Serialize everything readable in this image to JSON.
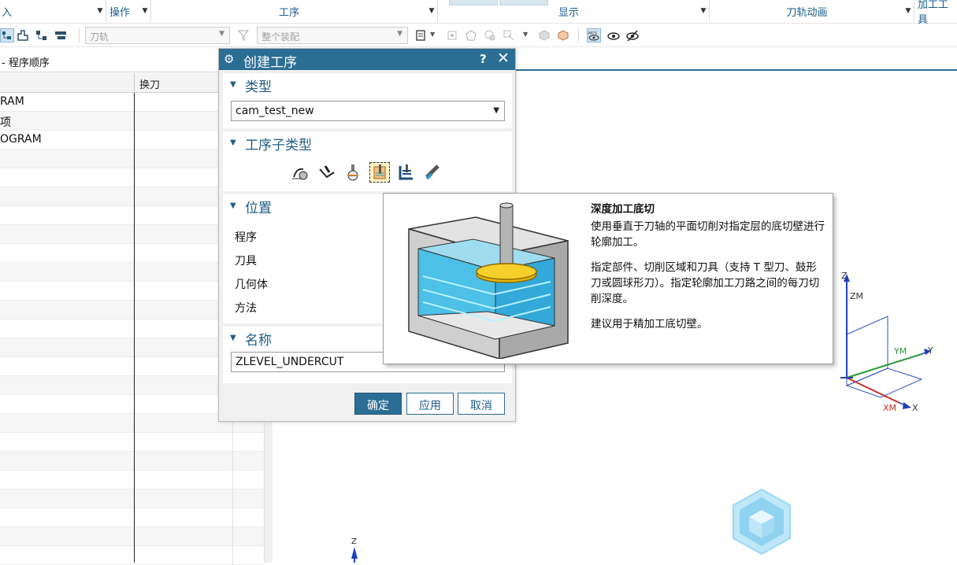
{
  "ribbon": {
    "groups": [
      {
        "label": "入",
        "has_arrow": true
      },
      {
        "label": "操作",
        "has_arrow": true
      },
      {
        "label": "工序",
        "has_arrow": true
      },
      {
        "label": "显示",
        "has_arrow": true
      },
      {
        "label": "刀轨动画",
        "has_arrow": true
      },
      {
        "label": "加工工具",
        "has_arrow": false
      }
    ]
  },
  "toolbar": {
    "toolpath_combo": "刀轨",
    "assembly_combo": "整个装配"
  },
  "navigator": {
    "title": "- 程序顺序",
    "columns": [
      "",
      "换刀"
    ],
    "rows": [
      "RAM",
      "项",
      "OGRAM",
      "",
      "",
      "",
      "",
      "",
      "",
      "",
      "",
      "",
      "",
      "",
      "",
      "",
      "",
      "",
      "",
      "",
      "",
      "",
      "",
      "",
      ""
    ]
  },
  "dialog": {
    "title": "创建工序",
    "help": "?",
    "close": "✕",
    "type_section": {
      "title": "类型",
      "value": "cam_test_new"
    },
    "subtype_section": {
      "title": "工序子类型",
      "icons": [
        "rest-milling-icon",
        "contour-profile-icon",
        "ball-mill-icon",
        "zlevel-undercut-icon",
        "corner-zlevel-icon",
        "flat-end-mill-icon"
      ],
      "selected_index": 3
    },
    "location_section": {
      "title": "位置",
      "fields": [
        "程序",
        "刀具",
        "几何体",
        "方法"
      ]
    },
    "name_section": {
      "title": "名称",
      "value": "ZLEVEL_UNDERCUT"
    },
    "buttons": {
      "ok": "确定",
      "apply": "应用",
      "cancel": "取消"
    }
  },
  "tooltip": {
    "title": "深度加工底切",
    "para1": "使用垂直于刀轴的平面切削对指定层的底切壁进行轮廓加工。",
    "para2": "指定部件、切削区域和刀具（支持 T 型刀、鼓形刀或圆球形刀）。指定轮廓加工刀路之间的每刀切削深度。",
    "para3": "建议用于精加工底切壁。"
  },
  "triad": {
    "z_label": "Z",
    "zm_label": "ZM",
    "ym_label": "YM",
    "y_label": "Y",
    "xm_label": "XM",
    "x_label": "X"
  },
  "mini_axis": {
    "z_label": "Z"
  },
  "colors": {
    "accent": "#2c6d94",
    "section_text": "#1f5d85",
    "z_axis": "#1f3fbf",
    "y_axis": "#2a9a3a",
    "x_axis": "#c03030",
    "logo": "#8fd3f0"
  }
}
